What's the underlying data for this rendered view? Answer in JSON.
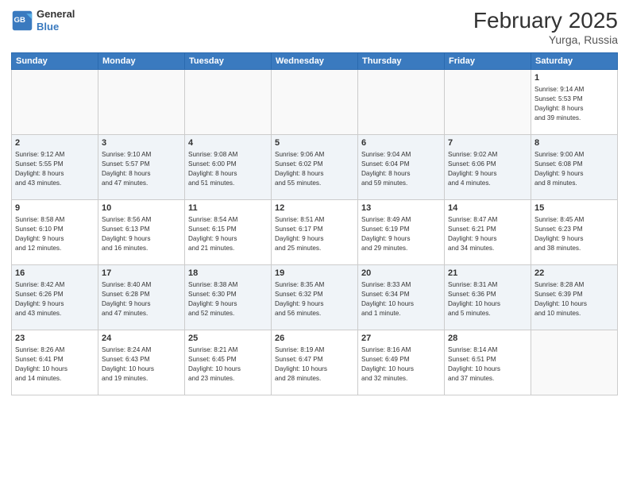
{
  "header": {
    "logo_line1": "General",
    "logo_line2": "Blue",
    "title": "February 2025",
    "subtitle": "Yurga, Russia"
  },
  "weekdays": [
    "Sunday",
    "Monday",
    "Tuesday",
    "Wednesday",
    "Thursday",
    "Friday",
    "Saturday"
  ],
  "weeks": [
    {
      "alt": false,
      "days": [
        {
          "num": "",
          "info": ""
        },
        {
          "num": "",
          "info": ""
        },
        {
          "num": "",
          "info": ""
        },
        {
          "num": "",
          "info": ""
        },
        {
          "num": "",
          "info": ""
        },
        {
          "num": "",
          "info": ""
        },
        {
          "num": "1",
          "info": "Sunrise: 9:14 AM\nSunset: 5:53 PM\nDaylight: 8 hours\nand 39 minutes."
        }
      ]
    },
    {
      "alt": true,
      "days": [
        {
          "num": "2",
          "info": "Sunrise: 9:12 AM\nSunset: 5:55 PM\nDaylight: 8 hours\nand 43 minutes."
        },
        {
          "num": "3",
          "info": "Sunrise: 9:10 AM\nSunset: 5:57 PM\nDaylight: 8 hours\nand 47 minutes."
        },
        {
          "num": "4",
          "info": "Sunrise: 9:08 AM\nSunset: 6:00 PM\nDaylight: 8 hours\nand 51 minutes."
        },
        {
          "num": "5",
          "info": "Sunrise: 9:06 AM\nSunset: 6:02 PM\nDaylight: 8 hours\nand 55 minutes."
        },
        {
          "num": "6",
          "info": "Sunrise: 9:04 AM\nSunset: 6:04 PM\nDaylight: 8 hours\nand 59 minutes."
        },
        {
          "num": "7",
          "info": "Sunrise: 9:02 AM\nSunset: 6:06 PM\nDaylight: 9 hours\nand 4 minutes."
        },
        {
          "num": "8",
          "info": "Sunrise: 9:00 AM\nSunset: 6:08 PM\nDaylight: 9 hours\nand 8 minutes."
        }
      ]
    },
    {
      "alt": false,
      "days": [
        {
          "num": "9",
          "info": "Sunrise: 8:58 AM\nSunset: 6:10 PM\nDaylight: 9 hours\nand 12 minutes."
        },
        {
          "num": "10",
          "info": "Sunrise: 8:56 AM\nSunset: 6:13 PM\nDaylight: 9 hours\nand 16 minutes."
        },
        {
          "num": "11",
          "info": "Sunrise: 8:54 AM\nSunset: 6:15 PM\nDaylight: 9 hours\nand 21 minutes."
        },
        {
          "num": "12",
          "info": "Sunrise: 8:51 AM\nSunset: 6:17 PM\nDaylight: 9 hours\nand 25 minutes."
        },
        {
          "num": "13",
          "info": "Sunrise: 8:49 AM\nSunset: 6:19 PM\nDaylight: 9 hours\nand 29 minutes."
        },
        {
          "num": "14",
          "info": "Sunrise: 8:47 AM\nSunset: 6:21 PM\nDaylight: 9 hours\nand 34 minutes."
        },
        {
          "num": "15",
          "info": "Sunrise: 8:45 AM\nSunset: 6:23 PM\nDaylight: 9 hours\nand 38 minutes."
        }
      ]
    },
    {
      "alt": true,
      "days": [
        {
          "num": "16",
          "info": "Sunrise: 8:42 AM\nSunset: 6:26 PM\nDaylight: 9 hours\nand 43 minutes."
        },
        {
          "num": "17",
          "info": "Sunrise: 8:40 AM\nSunset: 6:28 PM\nDaylight: 9 hours\nand 47 minutes."
        },
        {
          "num": "18",
          "info": "Sunrise: 8:38 AM\nSunset: 6:30 PM\nDaylight: 9 hours\nand 52 minutes."
        },
        {
          "num": "19",
          "info": "Sunrise: 8:35 AM\nSunset: 6:32 PM\nDaylight: 9 hours\nand 56 minutes."
        },
        {
          "num": "20",
          "info": "Sunrise: 8:33 AM\nSunset: 6:34 PM\nDaylight: 10 hours\nand 1 minute."
        },
        {
          "num": "21",
          "info": "Sunrise: 8:31 AM\nSunset: 6:36 PM\nDaylight: 10 hours\nand 5 minutes."
        },
        {
          "num": "22",
          "info": "Sunrise: 8:28 AM\nSunset: 6:39 PM\nDaylight: 10 hours\nand 10 minutes."
        }
      ]
    },
    {
      "alt": false,
      "days": [
        {
          "num": "23",
          "info": "Sunrise: 8:26 AM\nSunset: 6:41 PM\nDaylight: 10 hours\nand 14 minutes."
        },
        {
          "num": "24",
          "info": "Sunrise: 8:24 AM\nSunset: 6:43 PM\nDaylight: 10 hours\nand 19 minutes."
        },
        {
          "num": "25",
          "info": "Sunrise: 8:21 AM\nSunset: 6:45 PM\nDaylight: 10 hours\nand 23 minutes."
        },
        {
          "num": "26",
          "info": "Sunrise: 8:19 AM\nSunset: 6:47 PM\nDaylight: 10 hours\nand 28 minutes."
        },
        {
          "num": "27",
          "info": "Sunrise: 8:16 AM\nSunset: 6:49 PM\nDaylight: 10 hours\nand 32 minutes."
        },
        {
          "num": "28",
          "info": "Sunrise: 8:14 AM\nSunset: 6:51 PM\nDaylight: 10 hours\nand 37 minutes."
        },
        {
          "num": "",
          "info": ""
        }
      ]
    }
  ]
}
